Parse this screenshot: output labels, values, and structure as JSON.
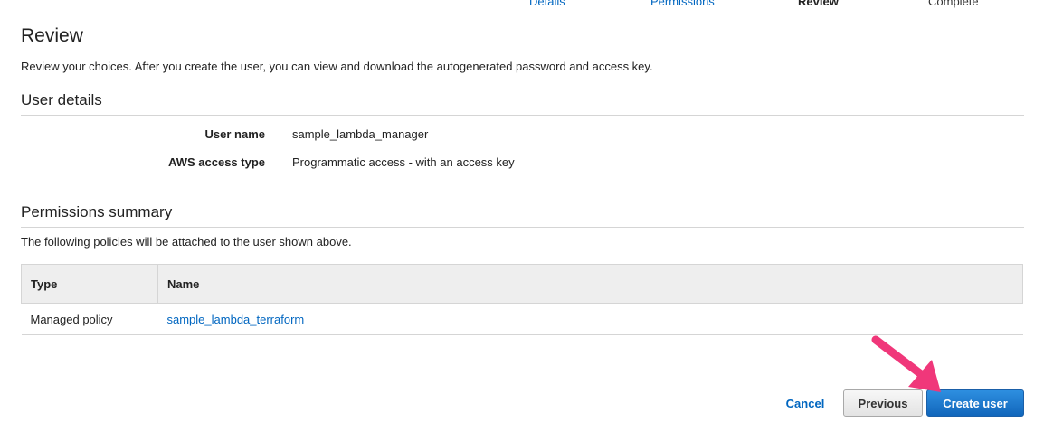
{
  "wizard": {
    "steps": [
      {
        "label": "Details"
      },
      {
        "label": "Permissions"
      },
      {
        "label": "Review"
      },
      {
        "label": "Complete"
      }
    ]
  },
  "review": {
    "title": "Review",
    "description": "Review your choices. After you create the user, you can view and download the autogenerated password and access key."
  },
  "user_details": {
    "title": "User details",
    "rows": [
      {
        "label": "User name",
        "value": "sample_lambda_manager"
      },
      {
        "label": "AWS access type",
        "value": "Programmatic access - with an access key"
      }
    ]
  },
  "permissions": {
    "title": "Permissions summary",
    "description": "The following policies will be attached to the user shown above.",
    "columns": [
      "Type",
      "Name"
    ],
    "rows": [
      {
        "type": "Managed policy",
        "name": "sample_lambda_terraform"
      }
    ]
  },
  "actions": {
    "cancel": "Cancel",
    "previous": "Previous",
    "create": "Create user"
  },
  "colors": {
    "link": "#0066c0",
    "primary_button": "#1a73cc",
    "annotation_arrow": "#f0377a"
  }
}
